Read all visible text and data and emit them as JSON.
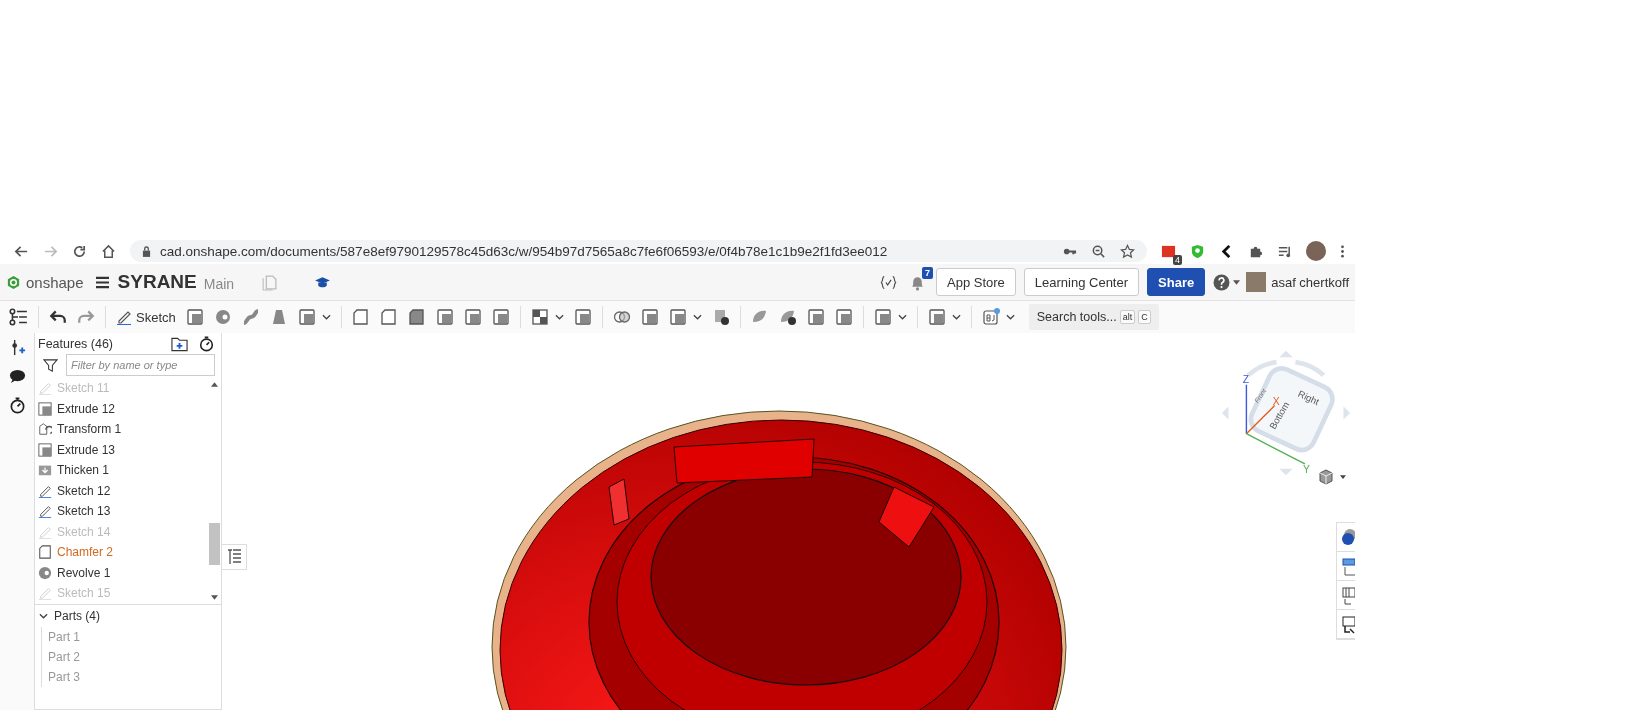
{
  "browser": {
    "url": "cad.onshape.com/documents/587e8ef9790129578c45d63c/w/954b97d7565a8c7fe6f06593/e/0f4b78e1c1b9e2f1fd3ee012",
    "extension_badge": "4"
  },
  "header": {
    "logo": "onshape",
    "document_title": "SYRANE",
    "workspace": "Main",
    "notification_count": "7",
    "user_name": "asaf chertkoff",
    "buttons": [
      {
        "label": "App Store",
        "kind": "outline"
      },
      {
        "label": "Learning Center",
        "kind": "outline"
      },
      {
        "label": "Share",
        "kind": "primary"
      }
    ]
  },
  "toolbar": {
    "sketch_label": "Sketch",
    "search": {
      "label": "Search tools...",
      "shortcut_keys": [
        "alt",
        "C"
      ]
    }
  },
  "feature_list": {
    "title": "Features (46)",
    "filter": {
      "placeholder": "Filter by name or type"
    },
    "features": [
      {
        "name": "Sketch 11",
        "kind": "sketch",
        "hidden": true,
        "selected": false
      },
      {
        "name": "Extrude 12",
        "kind": "extrude",
        "hidden": false,
        "selected": false
      },
      {
        "name": "Transform 1",
        "kind": "transform",
        "hidden": false,
        "selected": false
      },
      {
        "name": "Extrude 13",
        "kind": "extrude",
        "hidden": false,
        "selected": false
      },
      {
        "name": "Thicken 1",
        "kind": "thicken",
        "hidden": false,
        "selected": false
      },
      {
        "name": "Sketch 12",
        "kind": "sketch",
        "hidden": false,
        "selected": false
      },
      {
        "name": "Sketch 13",
        "kind": "sketch",
        "hidden": false,
        "selected": false
      },
      {
        "name": "Sketch 14",
        "kind": "sketch",
        "hidden": true,
        "selected": false
      },
      {
        "name": "Chamfer 2",
        "kind": "chamfer",
        "hidden": false,
        "selected": true
      },
      {
        "name": "Revolve 1",
        "kind": "revolve",
        "hidden": false,
        "selected": false
      },
      {
        "name": "Sketch 15",
        "kind": "sketch",
        "hidden": true,
        "selected": false
      }
    ],
    "parts_header": {
      "label": "Parts (4)",
      "expanded": true
    },
    "parts": [
      "Part 1",
      "Part 2",
      "Part 3"
    ]
  },
  "view_cube": {
    "faces": [
      "Front",
      "Right",
      "Bottom"
    ],
    "axes": [
      "Z",
      "X",
      "Y"
    ]
  }
}
